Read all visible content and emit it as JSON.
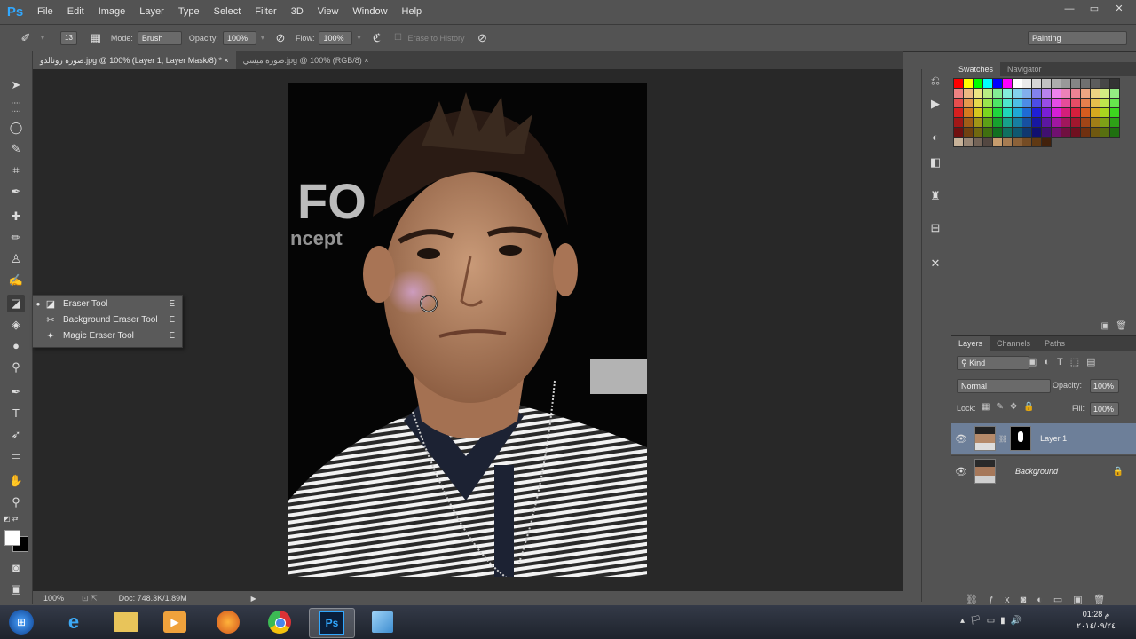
{
  "app": {
    "logo": "Ps"
  },
  "menu": [
    "File",
    "Edit",
    "Image",
    "Layer",
    "Type",
    "Select",
    "Filter",
    "3D",
    "View",
    "Window",
    "Help"
  ],
  "window_controls": [
    "—",
    "▭",
    "✕"
  ],
  "options": {
    "brush_size": "13",
    "mode_label": "Mode:",
    "mode_value": "Brush",
    "opacity_label": "Opacity:",
    "opacity_value": "100%",
    "flow_label": "Flow:",
    "flow_value": "100%",
    "erase_history": "Erase to History",
    "workspace": "Painting"
  },
  "tabs": [
    {
      "label": "صورة رونالدو.jpg @ 100% (Layer 1, Layer Mask/8) *",
      "close": "×"
    },
    {
      "label": "صورة ميسي.jpg @ 100% (RGB/8)",
      "close": "×"
    }
  ],
  "flyout": [
    {
      "label": "Eraser Tool",
      "key": "E",
      "selected": true
    },
    {
      "label": "Background Eraser Tool",
      "key": "E",
      "selected": false
    },
    {
      "label": "Magic Eraser Tool",
      "key": "E",
      "selected": false
    }
  ],
  "status": {
    "zoom": "100%",
    "doc": "Doc: 748.3K/1.89M"
  },
  "swatches_panel": {
    "tabs": [
      "Swatches",
      "Navigator"
    ]
  },
  "layers_panel": {
    "tabs": [
      "Layers",
      "Channels",
      "Paths"
    ],
    "filter_kind": "Kind",
    "blend_mode": "Normal",
    "opacity_label": "Opacity:",
    "opacity_value": "100%",
    "lock_label": "Lock:",
    "fill_label": "Fill:",
    "fill_value": "100%",
    "layers": [
      {
        "name": "Layer 1",
        "selected": true
      },
      {
        "name": "Background",
        "selected": false
      }
    ]
  },
  "canvas_text": {
    "logo_big": "FO",
    "logo_small": "ncept"
  },
  "taskbar": {
    "time": "01:28 م",
    "date": "٢٠١٤/٠٩/٢٤"
  },
  "colors": {
    "accent": "#31a8ff",
    "layer_selected": "#6d7f99"
  }
}
